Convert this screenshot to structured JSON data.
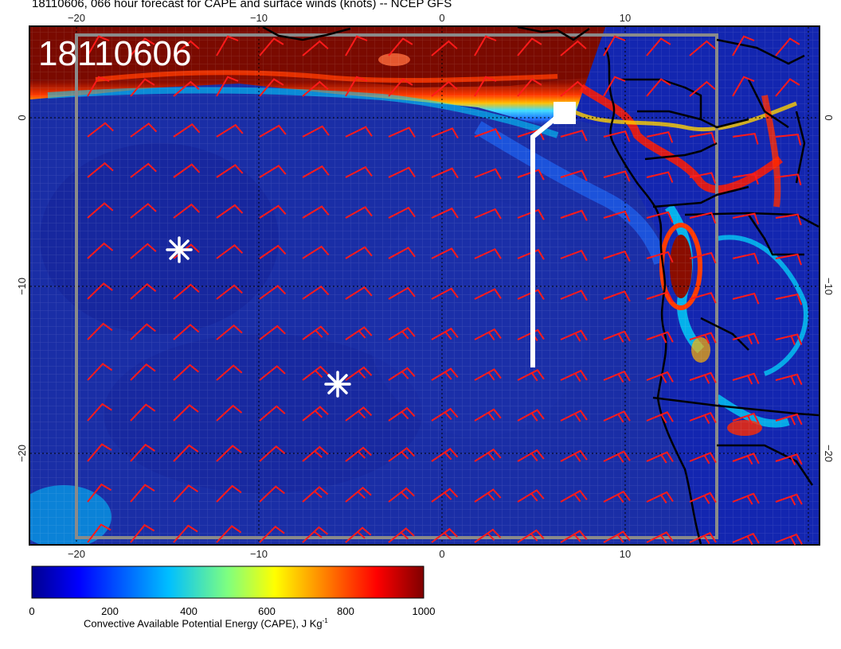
{
  "title": "18110606, 066 hour forecast for CAPE and surface winds (knots) -- NCEP GFS",
  "date_stamp": "18110606",
  "longitude_ticks": [
    "−20",
    "−10",
    "0",
    "10"
  ],
  "latitude_ticks": [
    "0",
    "−10",
    "−20"
  ],
  "colorbar": {
    "label": "Convective Available Potential Energy (CAPE), J Kg",
    "label_exponent": "-1",
    "ticks": [
      "0",
      "200",
      "400",
      "600",
      "800",
      "1000"
    ],
    "colors": [
      "#00008f",
      "#0000ff",
      "#00bfff",
      "#7fff7f",
      "#ffff00",
      "#ff7f00",
      "#ff0000",
      "#7f0000"
    ]
  },
  "colors": {
    "ocean_low_cape": "#1a2ea6",
    "high_cape": "#7a0a00",
    "wind_barbs": "#ff1a1a",
    "coastline": "#000000",
    "markers": "#ffffff"
  }
}
